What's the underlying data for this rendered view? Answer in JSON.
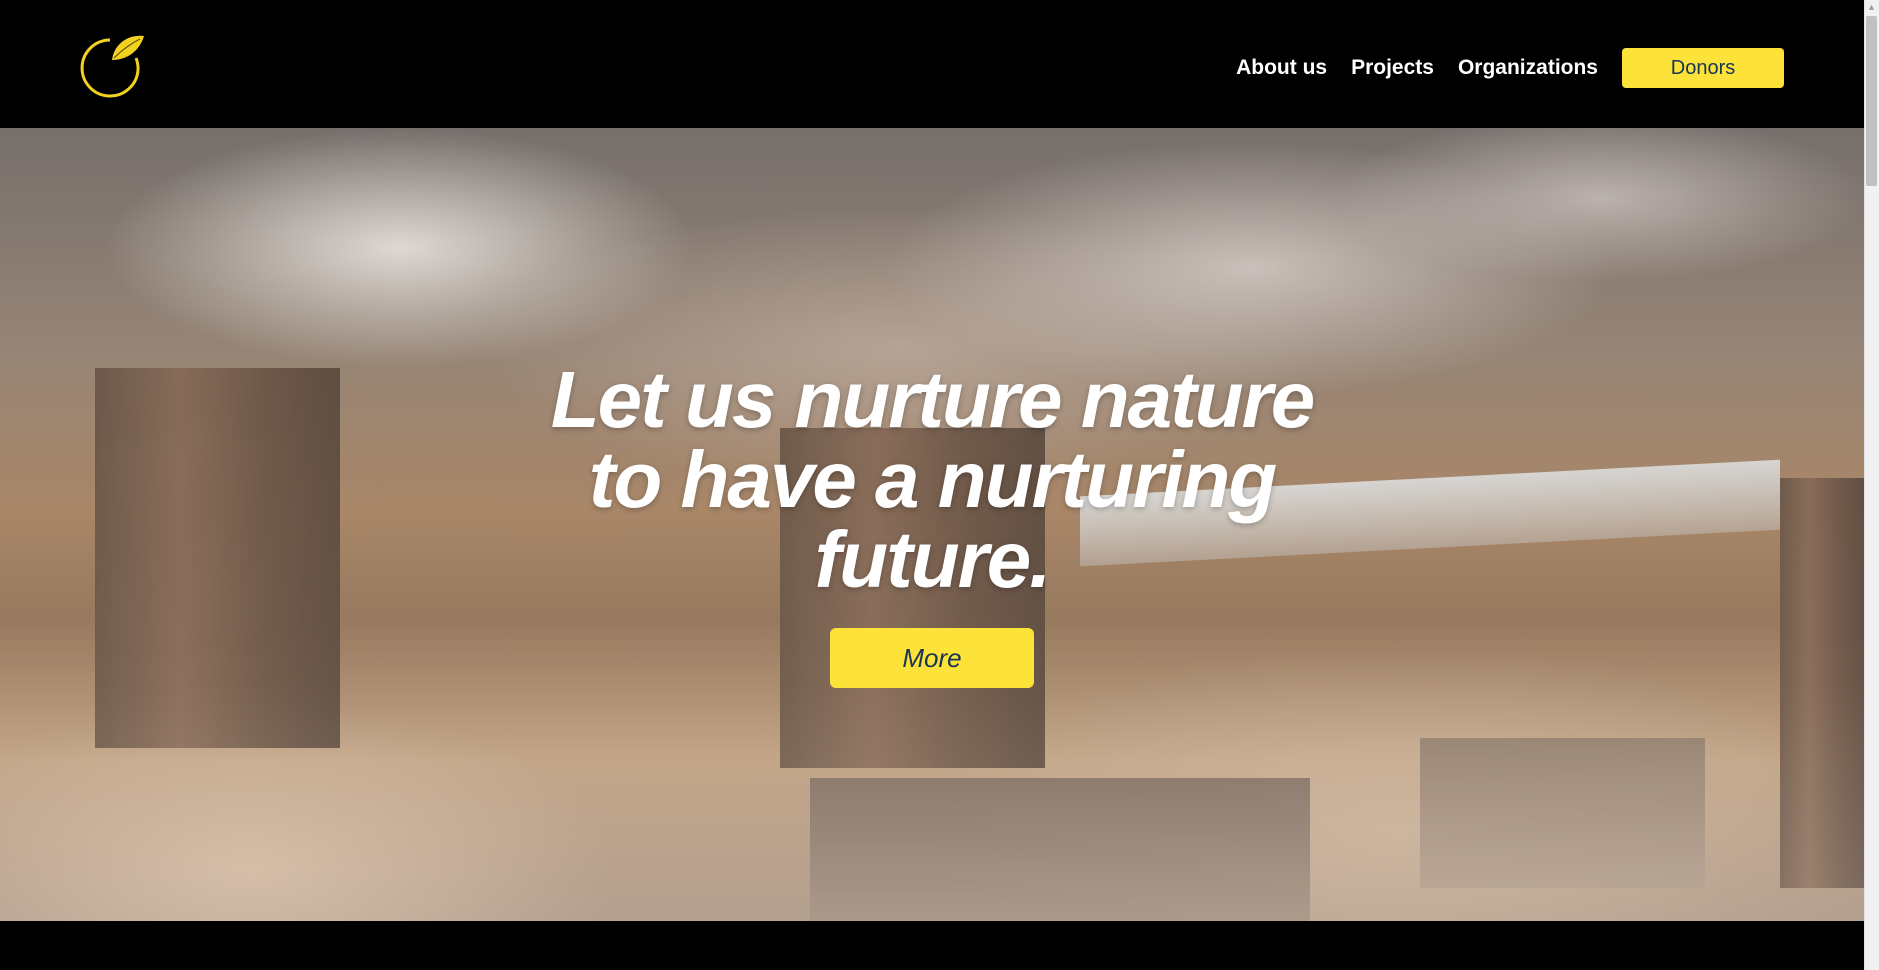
{
  "nav": {
    "links": [
      "About us",
      "Projects",
      "Organizations"
    ],
    "donors_label": "Donors"
  },
  "hero": {
    "title_lines": [
      "Let us nurture nature",
      "to have a nurturing",
      "future."
    ],
    "more_label": "More"
  },
  "colors": {
    "accent_yellow": "#fde23a",
    "button_text_navy": "#173654",
    "header_bg": "#000000"
  },
  "icons": {
    "logo": "leaf-circle-logo",
    "scroll_up": "scroll-up-arrow-icon"
  }
}
